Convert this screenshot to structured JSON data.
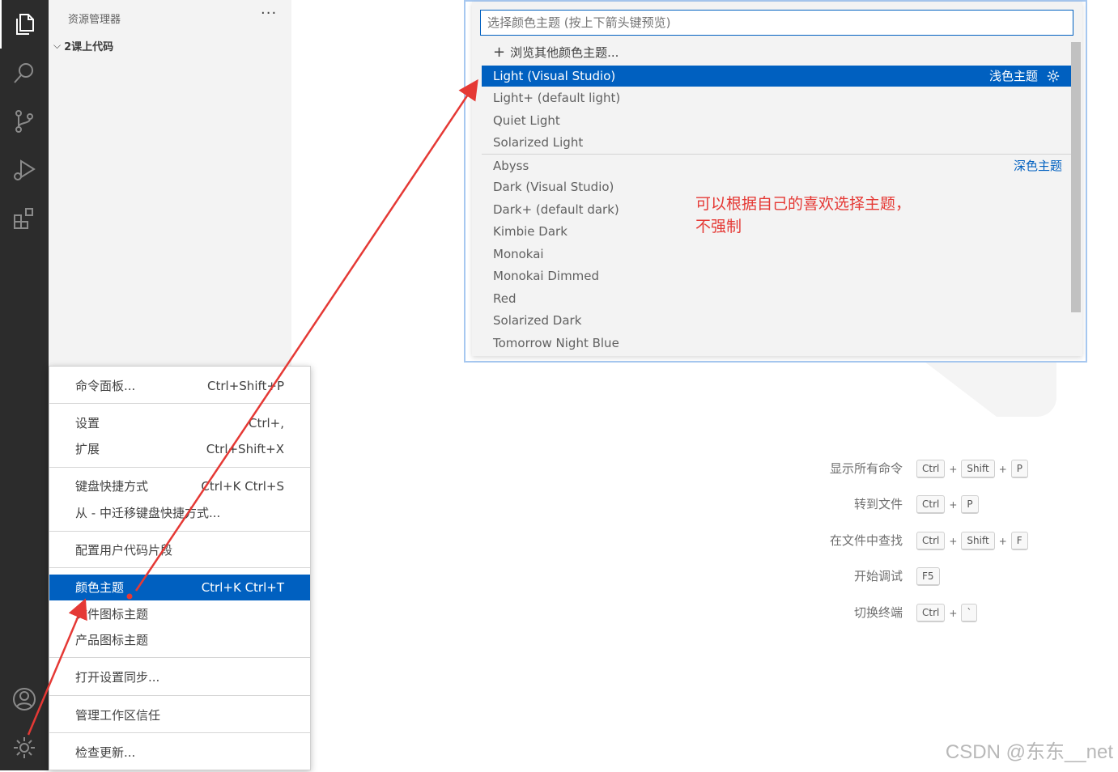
{
  "explorer": {
    "title": "资源管理器",
    "more": "···",
    "folder_name": "2课上代码"
  },
  "quick_pick": {
    "placeholder": "选择颜色主题 (按上下箭头键预览)",
    "browse": "浏览其他颜色主题...",
    "light_items": [
      "Light (Visual Studio)",
      "Light+ (default light)",
      "Quiet Light",
      "Solarized Light"
    ],
    "light_tag": "浅色主题",
    "dark_items": [
      "Abyss",
      "Dark (Visual Studio)",
      "Dark+ (default dark)",
      "Kimbie Dark",
      "Monokai",
      "Monokai Dimmed",
      "Red",
      "Solarized Dark",
      "Tomorrow Night Blue"
    ],
    "dark_tag": "深色主题",
    "selected": "Light (Visual Studio)"
  },
  "annotation": {
    "line1": "可以根据自己的喜欢选择主题，",
    "line2": "不强制",
    "color": "#e53935"
  },
  "menu": {
    "items": [
      {
        "label": "命令面板...",
        "shortcut": "Ctrl+Shift+P"
      },
      {
        "label": "设置",
        "shortcut": "Ctrl+,"
      },
      {
        "label": "扩展",
        "shortcut": "Ctrl+Shift+X"
      },
      {
        "label": "键盘快捷方式",
        "shortcut": "Ctrl+K Ctrl+S"
      },
      {
        "label": "从 - 中迁移键盘快捷方式...",
        "shortcut": ""
      },
      {
        "label": "配置用户代码片段",
        "shortcut": ""
      },
      {
        "label": "颜色主题",
        "shortcut": "Ctrl+K Ctrl+T"
      },
      {
        "label": "文件图标主题",
        "shortcut": ""
      },
      {
        "label": "产品图标主题",
        "shortcut": ""
      },
      {
        "label": "打开设置同步...",
        "shortcut": ""
      },
      {
        "label": "管理工作区信任",
        "shortcut": ""
      },
      {
        "label": "检查更新...",
        "shortcut": ""
      }
    ]
  },
  "shortcuts": [
    {
      "label": "显示所有命令",
      "keys": [
        "Ctrl",
        "Shift",
        "P"
      ]
    },
    {
      "label": "转到文件",
      "keys": [
        "Ctrl",
        "P"
      ]
    },
    {
      "label": "在文件中查找",
      "keys": [
        "Ctrl",
        "Shift",
        "F"
      ]
    },
    {
      "label": "开始调试",
      "keys": [
        "F5"
      ]
    },
    {
      "label": "切换终端",
      "keys": [
        "Ctrl",
        "`"
      ]
    }
  ],
  "key_plus": "+",
  "watermark": "CSDN @东东__net",
  "colors": {
    "accent": "#0060c0",
    "activity_bar": "#2c2c2c",
    "sidebar": "#f3f3f3",
    "arrow": "#e53935"
  },
  "icons": [
    "explorer-icon",
    "search-icon",
    "source-control-icon",
    "run-debug-icon",
    "extensions-icon",
    "account-icon",
    "gear-icon"
  ]
}
